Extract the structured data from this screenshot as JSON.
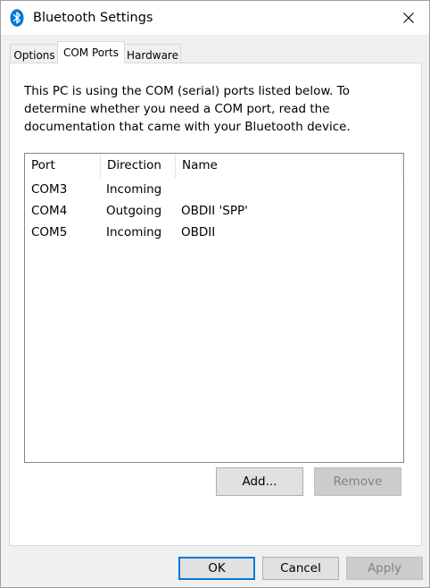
{
  "window": {
    "title": "Bluetooth Settings",
    "accent_color": "#0078d7",
    "icon": "bluetooth-icon",
    "close_icon": "close-icon"
  },
  "tabs": [
    {
      "label": "Options",
      "selected": false
    },
    {
      "label": "COM Ports",
      "selected": true
    },
    {
      "label": "Hardware",
      "selected": false
    }
  ],
  "com_ports": {
    "description": "This PC is using the COM (serial) ports listed below. To determine whether you need a COM port, read the documentation that came with your Bluetooth device.",
    "columns": [
      "Port",
      "Direction",
      "Name"
    ],
    "rows": [
      {
        "port": "COM3",
        "direction": "Incoming",
        "name": ""
      },
      {
        "port": "COM4",
        "direction": "Outgoing",
        "name": "OBDII 'SPP'"
      },
      {
        "port": "COM5",
        "direction": "Incoming",
        "name": "OBDII"
      }
    ],
    "add_label": "Add...",
    "remove_label": "Remove"
  },
  "footer": {
    "ok_label": "OK",
    "cancel_label": "Cancel",
    "apply_label": "Apply"
  }
}
